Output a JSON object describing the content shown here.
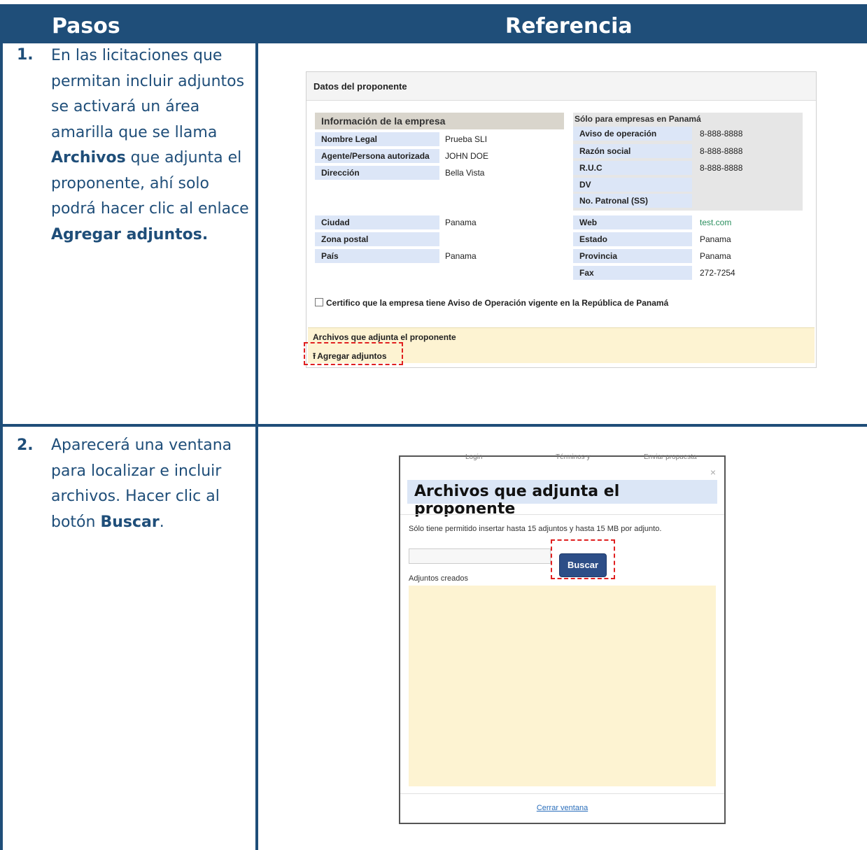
{
  "header": {
    "col1": "Pasos",
    "col2": "Referencia"
  },
  "steps": [
    {
      "num": "1.",
      "parts": [
        "En las licitaciones que permitan incluir adjuntos se activará un área amarilla que se llama ",
        "Archivos",
        " que adjunta el proponente, ahí solo podrá hacer clic al enlace ",
        "Agregar adjuntos."
      ]
    },
    {
      "num": "2.",
      "parts": [
        "Aparecerá una ventana para localizar e incluir archivos. Hacer clic al botón ",
        "Buscar",
        "."
      ]
    }
  ],
  "shot1": {
    "panel_title": "Datos del proponente",
    "section_title": "Información de la empresa",
    "left_fields": [
      {
        "label": "Nombre Legal",
        "value": "Prueba SLI"
      },
      {
        "label": "Agente/Persona autorizada",
        "value": "JOHN DOE"
      },
      {
        "label": "Dirección",
        "value": "Bella Vista"
      },
      {
        "label": "Ciudad",
        "value": "Panama"
      },
      {
        "label": "Zona postal",
        "value": ""
      },
      {
        "label": "País",
        "value": "Panama"
      }
    ],
    "right_title": "Sólo para empresas en Panamá",
    "right_fields": [
      {
        "label": "Aviso de operación",
        "value": "8-888-8888"
      },
      {
        "label": "Razón social",
        "value": "8-888-8888"
      },
      {
        "label": "R.U.C",
        "value": "8-888-8888"
      },
      {
        "label": "DV",
        "value": ""
      },
      {
        "label": "No. Patronal (SS)",
        "value": ""
      },
      {
        "label": "Web",
        "value": "test.com"
      },
      {
        "label": "Estado",
        "value": "Panama"
      },
      {
        "label": "Provincia",
        "value": "Panama"
      },
      {
        "label": "Fax",
        "value": "272-7254"
      }
    ],
    "certify_text": "Certifico que la empresa tiene Aviso de Operación vigente en la República de Panamá",
    "yellow_title": "Archivos que adjunta el proponente",
    "add_link": "Agregar adjuntos",
    "upload_icon": "upload-icon"
  },
  "shot2": {
    "bg_peek": [
      "Login",
      "Términos y",
      "Enviar propuesta"
    ],
    "close_glyph": "×",
    "title": "Archivos que adjunta el proponente",
    "note": "Sólo tiene permitido insertar hasta 15 adjuntos y hasta 15 MB por adjunto.",
    "buscar": "Buscar",
    "created_label": "Adjuntos creados",
    "close_link": "Cerrar ventana"
  },
  "colors": {
    "header": "#1f4e79",
    "highlight": "#e02020",
    "yellow": "#fdf3d2",
    "button": "#2d4e87"
  }
}
